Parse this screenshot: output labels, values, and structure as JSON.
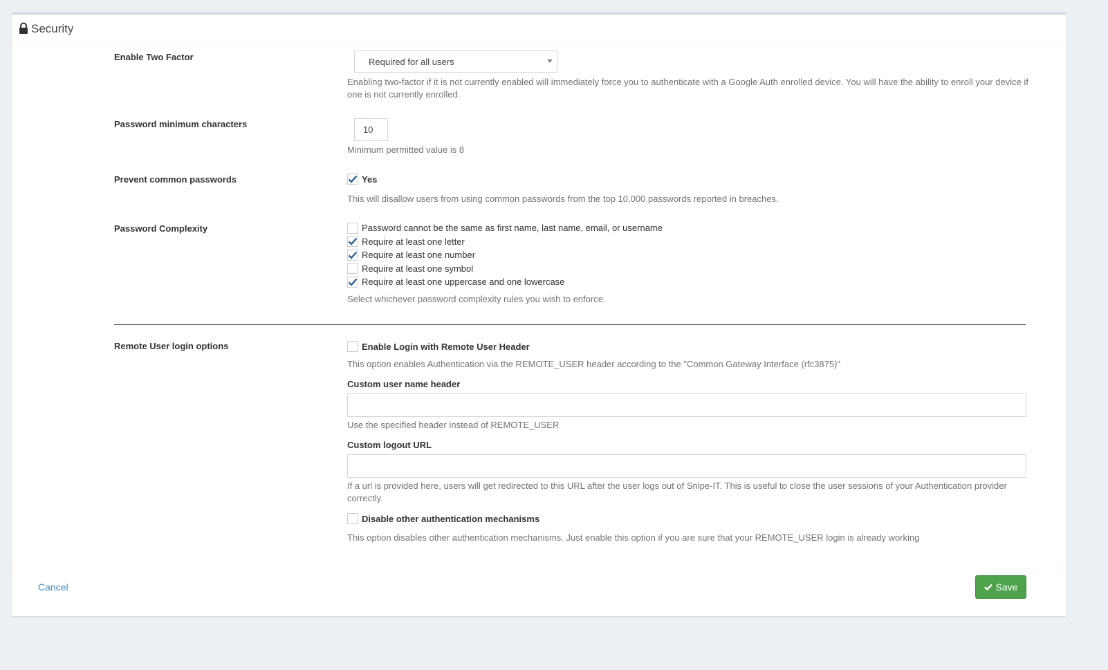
{
  "section": {
    "title": "Security",
    "icon": "lock-icon"
  },
  "two_factor": {
    "label": "Enable Two Factor",
    "selected": "Required for all users",
    "help": "Enabling two-factor if it is not currently enabled will immediately force you to authenticate with a Google Auth enrolled device. You will have the ability to enroll your device if one is not currently enrolled."
  },
  "pw_min": {
    "label": "Password minimum characters",
    "value": "10",
    "help": "Minimum permitted value is 8"
  },
  "prevent_common": {
    "label": "Prevent common passwords",
    "checkbox_label": "Yes",
    "checked": true,
    "help": "This will disallow users from using common passwords from the top 10,000 passwords reported in breaches."
  },
  "complexity": {
    "label": "Password Complexity",
    "rules": [
      {
        "label": "Password cannot be the same as first name, last name, email, or username",
        "checked": false
      },
      {
        "label": "Require at least one letter",
        "checked": true
      },
      {
        "label": "Require at least one number",
        "checked": true
      },
      {
        "label": "Require at least one symbol",
        "checked": false
      },
      {
        "label": "Require at least one uppercase and one lowercase",
        "checked": true
      }
    ],
    "help": "Select whichever password complexity rules you wish to enforce."
  },
  "remote_user": {
    "label": "Remote User login options",
    "enable_label": "Enable Login with Remote User Header",
    "enable_checked": false,
    "enable_help": "This option enables Authentication via the REMOTE_USER header according to the \"Common Gateway Interface (rfc3875)\"",
    "header_label": "Custom user name header",
    "header_value": "",
    "header_help": "Use the specified header instead of REMOTE_USER",
    "logout_label": "Custom logout URL",
    "logout_value": "",
    "logout_help": "If a url is provided here, users will get redirected to this URL after the user logs out of Snipe-IT. This is useful to close the user sessions of your Authentication provider correctly.",
    "disable_label": "Disable other authentication mechanisms",
    "disable_checked": false,
    "disable_help": "This option disables other authentication mechanisms. Just enable this option if you are sure that your REMOTE_USER login is already working"
  },
  "footer": {
    "cancel_label": "Cancel",
    "save_label": "Save"
  },
  "colors": {
    "link": "#3c8dbc",
    "save_button": "#4ea24c",
    "checkmark": "#2a6496"
  }
}
